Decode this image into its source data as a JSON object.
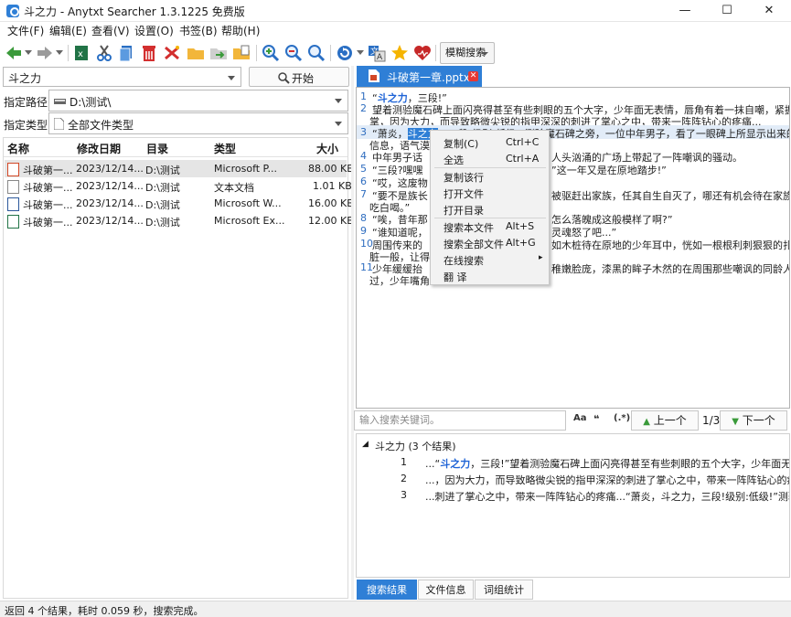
{
  "window": {
    "title": "斗之力 - Anytxt Searcher 1.3.1225 免费版",
    "minimize": "—",
    "maximize": "☐",
    "close": "✕"
  },
  "menu": [
    "文件(F)",
    "编辑(E)",
    "查看(V)",
    "设置(O)",
    "书签(B)",
    "帮助(H)"
  ],
  "toolbar": {
    "icons": [
      "back-icon",
      "forward-icon",
      "excel-export-icon",
      "cut-icon",
      "copy-icon",
      "delete-icon",
      "clean-icon",
      "folder-icon",
      "move-icon",
      "export-icon",
      "zoom-in-icon",
      "zoom-out-icon",
      "search-icon",
      "refresh-icon",
      "translate-icon",
      "star-icon",
      "heart-icon"
    ],
    "mode_label": "模糊搜索"
  },
  "search": {
    "query": "斗之力",
    "start_label": "开始",
    "path_label": "指定路径:",
    "path_value": "D:\\测试\\",
    "type_label": "指定类型:",
    "type_value": "全部文件类型"
  },
  "results": {
    "columns": [
      "名称",
      "修改日期",
      "目录",
      "类型",
      "大小"
    ],
    "rows": [
      {
        "name": "斗破第一...",
        "date": "2023/12/14...",
        "dir": "D:\\测试",
        "type": "Microsoft P...",
        "size": "88.00 KB",
        "icon": "ppt",
        "color": "#d24726"
      },
      {
        "name": "斗破第一...",
        "date": "2023/12/14...",
        "dir": "D:\\测试",
        "type": "文本文档",
        "size": "1.01 KB",
        "icon": "txt",
        "color": "#888888"
      },
      {
        "name": "斗破第一...",
        "date": "2023/12/14...",
        "dir": "D:\\测试",
        "type": "Microsoft W...",
        "size": "16.00 KB",
        "icon": "word",
        "color": "#2b579a"
      },
      {
        "name": "斗破第一...",
        "date": "2023/12/14...",
        "dir": "D:\\测试",
        "type": "Microsoft Ex...",
        "size": "12.00 KB",
        "icon": "excel",
        "color": "#217346"
      }
    ]
  },
  "document": {
    "tab_title": "斗破第一章.pptx",
    "lines": [
      {
        "n": "1",
        "pre": "“",
        "kw": "斗之力",
        "post": "，三段!”"
      },
      {
        "n": "2",
        "text": "    望着测验魔石碑上面闪亮得甚至有些刺眼的五个大字，少年面无表情，唇角有着一抹自嘲，紧握的手"
      },
      {
        "n": "",
        "text": "掌，因为大力，而导致略微尖锐的指甲深深的刺进了掌心之中，带来一阵阵钻心的疼痛..."
      },
      {
        "n": "3",
        "pre": "    “萧炎，",
        "hl": "斗之力",
        "post": "，三段!级别:低级!”测验魔石碑之旁，一位中年男子，看了一眼碑上所显示出来的"
      },
      {
        "n": "",
        "text": "信息，语气漠"
      },
      {
        "n": "4",
        "text": "    中年男子话",
        "tail": "人头汹涌的广场上带起了一阵嘲讽的骚动。"
      },
      {
        "n": "5",
        "text": "    “三段?嘿嘿",
        "tail": "”这一年又是在原地踏步!”"
      },
      {
        "n": "6",
        "text": "    “哎，这废物"
      },
      {
        "n": "7",
        "text": "    “要不是族长",
        "tail": "被驱赶出家族，任其自生自灭了，哪还有机会待在家族中白"
      },
      {
        "n": "",
        "text": "吃白喝。”"
      },
      {
        "n": "8",
        "text": "    “唉，昔年那",
        "tail": "怎么落魄成这般模样了啊?”"
      },
      {
        "n": "9",
        "text": "    “谁知道呢，",
        "tail": "灵魂怒了吧...”"
      },
      {
        "n": "10",
        "text": "    周围传来的",
        "tail": "如木桩待在原地的少年耳中，恍如一根根利刺狠狠的扎在心"
      },
      {
        "n": "",
        "text": "脏一般，让得少"
      },
      {
        "n": "11",
        "text": "    少年缓缓抬",
        "tail": "稚嫩脸庞，漆黑的眸子木然的在周围那些嘲讽的同龄人身上扫"
      },
      {
        "n": "",
        "text": "过，少年嘴角的"
      }
    ]
  },
  "context_menu": {
    "items": [
      {
        "label": "复制(C)",
        "key": "Ctrl+C"
      },
      {
        "label": "全选",
        "key": "Ctrl+A"
      },
      {
        "label": "复制该行",
        "key": ""
      },
      {
        "label": "打开文件",
        "key": ""
      },
      {
        "label": "打开目录",
        "key": ""
      },
      {
        "label": "搜索本文件",
        "key": "Alt+S"
      },
      {
        "label": "搜索全部文件",
        "key": "Alt+G"
      },
      {
        "label": "在线搜索",
        "key": "▸"
      },
      {
        "label": "翻 译",
        "key": ""
      }
    ]
  },
  "find": {
    "placeholder": "输入搜索关键词。",
    "opt_case": "Aa",
    "opt_word": "❝",
    "opt_regex": "(.*)",
    "prev_label": "上一个",
    "counter": "1/3",
    "next_label": "下一个"
  },
  "tree": {
    "header": "斗之力 (3 个结果)",
    "items": [
      {
        "n": "1",
        "pre": "...“",
        "kw": "斗之力",
        "post": "，三段!”望着测验魔石碑上面闪亮得甚至有些刺眼的五个大字，少年面无表情，"
      },
      {
        "n": "2",
        "text": "...，因为大力，而导致略微尖锐的指甲深深的刺进了掌心之中，带来一阵阵钻心的疼痛...“..."
      },
      {
        "n": "3",
        "text": "...刺进了掌心之中，带来一阵阵钻心的疼痛...“萧炎，斗之力，三段!级别:低级!”测验魔..."
      }
    ]
  },
  "bottom_tabs": [
    "搜索结果",
    "文件信息",
    "词组统计"
  ],
  "status": "返回 4 个结果，耗时 0.059 秒，搜索完成。"
}
